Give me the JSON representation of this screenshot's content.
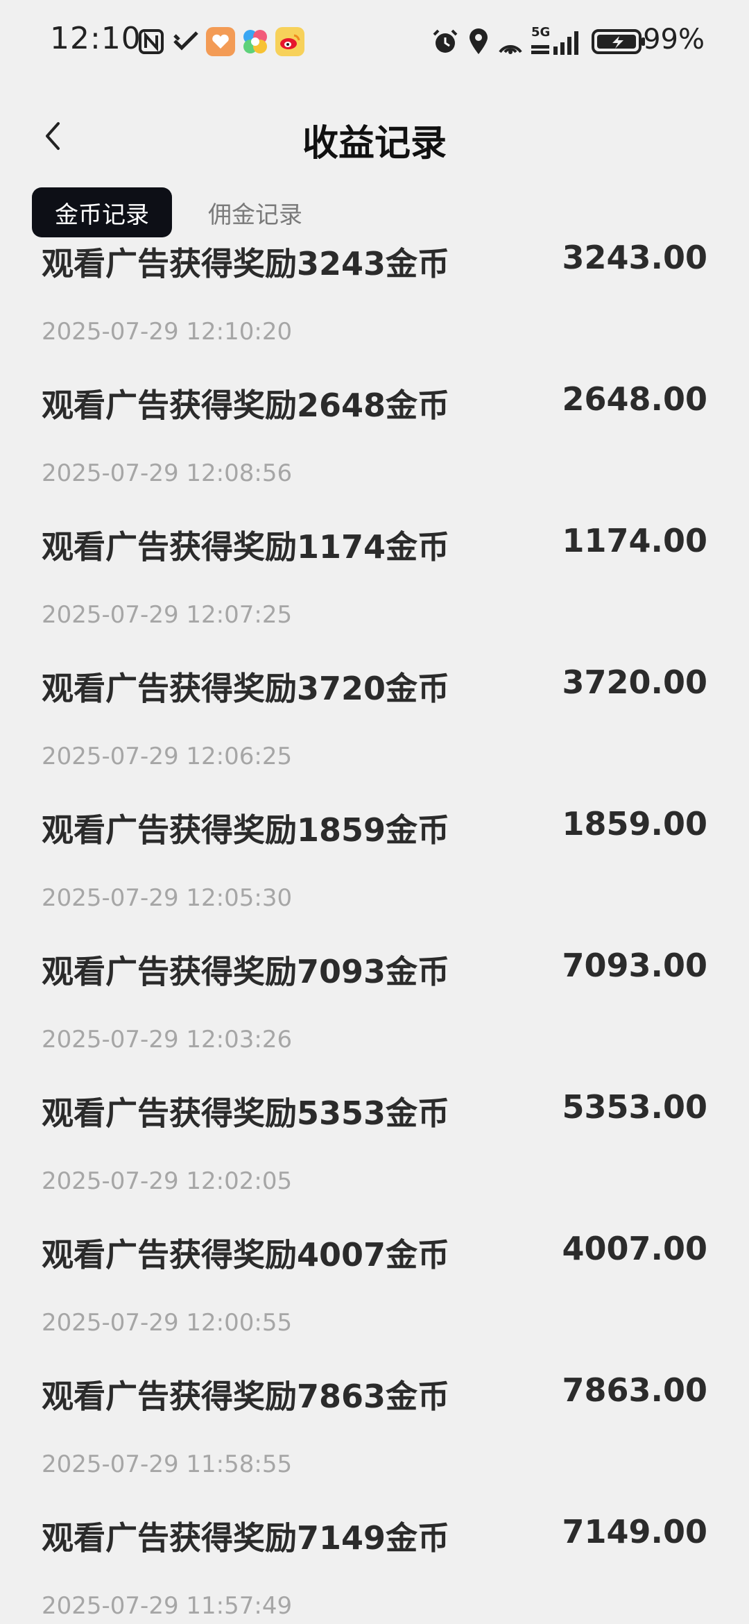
{
  "status_bar": {
    "time": "12:10",
    "network_label": "5G",
    "battery_percent": "99%"
  },
  "header": {
    "title": "收益记录"
  },
  "tabs": [
    {
      "label": "金币记录",
      "active": true
    },
    {
      "label": "佣金记录",
      "active": false
    }
  ],
  "records": [
    {
      "title": "观看广告获得奖励3243金币",
      "amount": "3243.00",
      "time": "2025-07-29 12:10:20"
    },
    {
      "title": "观看广告获得奖励2648金币",
      "amount": "2648.00",
      "time": "2025-07-29 12:08:56"
    },
    {
      "title": "观看广告获得奖励1174金币",
      "amount": "1174.00",
      "time": "2025-07-29 12:07:25"
    },
    {
      "title": "观看广告获得奖励3720金币",
      "amount": "3720.00",
      "time": "2025-07-29 12:06:25"
    },
    {
      "title": "观看广告获得奖励1859金币",
      "amount": "1859.00",
      "time": "2025-07-29 12:05:30"
    },
    {
      "title": "观看广告获得奖励7093金币",
      "amount": "7093.00",
      "time": "2025-07-29 12:03:26"
    },
    {
      "title": "观看广告获得奖励5353金币",
      "amount": "5353.00",
      "time": "2025-07-29 12:02:05"
    },
    {
      "title": "观看广告获得奖励4007金币",
      "amount": "4007.00",
      "time": "2025-07-29 12:00:55"
    },
    {
      "title": "观看广告获得奖励7863金币",
      "amount": "7863.00",
      "time": "2025-07-29 11:58:55"
    },
    {
      "title": "观看广告获得奖励7149金币",
      "amount": "7149.00",
      "time": "2025-07-29 11:57:49"
    }
  ],
  "colors": {
    "background": "#f0f0f0",
    "active_tab_bg": "#0d0f16",
    "record_text": "#2b2b2b",
    "timestamp_text": "#a6a6a6"
  },
  "icons": {
    "status_bar": [
      "nfc-icon",
      "app-check-icon",
      "app-heart-icon",
      "app-colorful-icon",
      "weibo-icon",
      "alarm-icon",
      "location-icon",
      "hotspot-icon",
      "signal-icon",
      "battery-icon"
    ],
    "header": [
      "back-chevron-icon"
    ]
  }
}
